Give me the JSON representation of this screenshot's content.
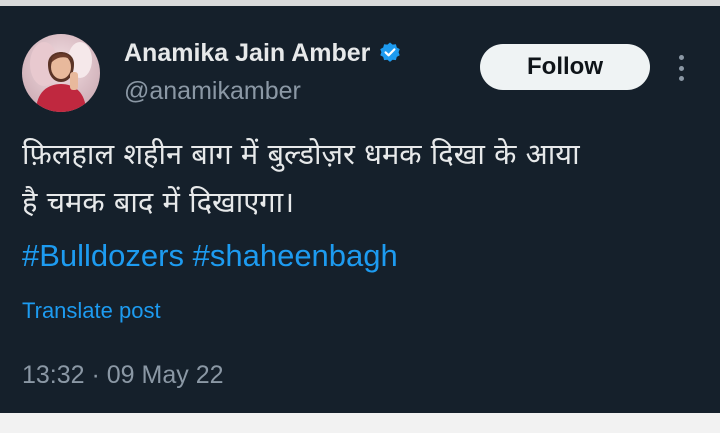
{
  "author": {
    "display_name": "Anamika Jain Amber",
    "handle": "@anamikamber",
    "verified_icon": "verified-badge-icon",
    "avatar_icon": "profile-avatar"
  },
  "actions": {
    "follow_label": "Follow",
    "more_icon": "more-vertical-icon"
  },
  "tweet": {
    "line1": "फ़िलहाल शहीन बाग में बुल्डोज़र धमक दिखा के आया",
    "line2": "है चमक बाद में दिखाएगा।",
    "hashtag1": "#Bulldozers",
    "hashtag2": "#shaheenbagh",
    "translate_label": "Translate post",
    "timestamp": "13:32 · 09 May 22"
  },
  "colors": {
    "background": "#15202b",
    "text": "#e7e9ea",
    "secondary": "#8b98a5",
    "link": "#1d9bf0",
    "follow_bg": "#eff3f4"
  }
}
